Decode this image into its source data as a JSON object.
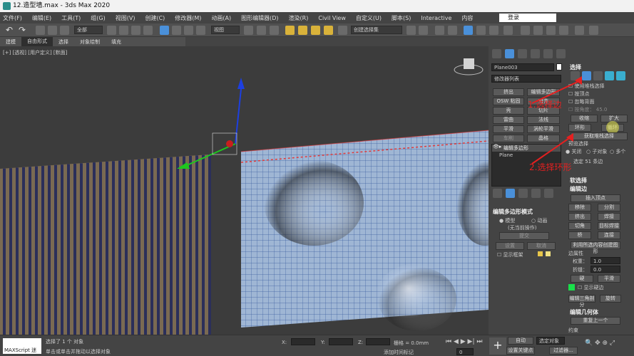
{
  "window": {
    "title": "12.造型墙.max - 3ds Max 2020"
  },
  "menu": {
    "items": [
      "文件(F)",
      "编辑(E)",
      "工具(T)",
      "组(G)",
      "视图(V)",
      "创建(C)",
      "修改器(M)",
      "动画(A)",
      "图形编辑器(D)",
      "渲染(R)",
      "Civil View",
      "自定义(U)",
      "脚本(S)",
      "Interactive",
      "内容"
    ],
    "login": "登录"
  },
  "toolbar": {
    "filter": "全部",
    "refcoord": "视图",
    "selset": "创建选择集"
  },
  "ribbon": {
    "tabs": [
      "建模",
      "自由形式",
      "选择",
      "对象绘制",
      "填充"
    ],
    "active": "自由形式"
  },
  "viewport": {
    "label": "[+] [透视] [用户定义] [默面]"
  },
  "panel": {
    "object_name": "Plane003",
    "modifier_list": "修改器列表",
    "quick_buttons": [
      "挤出",
      "编辑多边形",
      "OSW 粘固",
      "对齐",
      "壳",
      "切片",
      "雷曲",
      "法线",
      "平滑",
      "涡轮平滑",
      "车削",
      "晶格"
    ],
    "stack_items": [
      "编辑多边形",
      "Plane"
    ],
    "select_title": "选择",
    "select_opts": [
      "使用堆栈选择",
      "按顶点",
      "忽略背面",
      "按角度： 45.0"
    ],
    "select_btns": [
      "收缩",
      "扩大",
      "环形",
      "循环",
      "获取堆栈选择"
    ],
    "preview_title": "预览选择",
    "preview_opts": [
      "关闭",
      "子对象",
      "多个"
    ],
    "selected_info": "选定 51 条边",
    "soft_title": "软选择",
    "edit_edges_title": "编辑边",
    "edit_edges_btns": [
      "插入顶点",
      "移除",
      "分割",
      "挤出",
      "焊接",
      "切角",
      "目标焊接",
      "桥",
      "连接",
      "利用所选内容创建图形"
    ],
    "edge_props": {
      "label": "边属性",
      "weight_label": "权重：",
      "weight": "1.0",
      "crease_label": "折缝：",
      "crease": "0.0",
      "hard": "硬",
      "smooth": "平滑",
      "show_hard": "显示硬边"
    },
    "edit_tri": "编辑三角剖分",
    "rotate": "旋转",
    "edit_geo_title": "编辑几何体",
    "repeat_last": "重复上一个",
    "constraint": "约束",
    "edit_poly_mode_title": "编辑多边形模式",
    "mode_opts": [
      "模型",
      "动画"
    ],
    "no_op": "(无当前操作)",
    "commit": "提交",
    "settings": "设置",
    "cancel": "取消",
    "show_cage": "显示框架"
  },
  "annotations": {
    "step1": "1.选择边",
    "step2": "2.选择环形"
  },
  "status": {
    "script_label": "MAXScript 迷",
    "line1": "选择了 1 个 对象",
    "line2": "单击或单击并拖动以选择对象",
    "x_label": "X:",
    "y_label": "Y:",
    "z_label": "Z:",
    "grid": "栅格 = 0.0mm",
    "add_time_tag": "添加时间标记",
    "auto": "自动",
    "selected_obj": "选定对象",
    "set_key": "设置关键点",
    "filters": "过滤器...",
    "frame": "0"
  },
  "colors": {
    "accent": "#4a90d9",
    "annotation": "#e52020"
  }
}
